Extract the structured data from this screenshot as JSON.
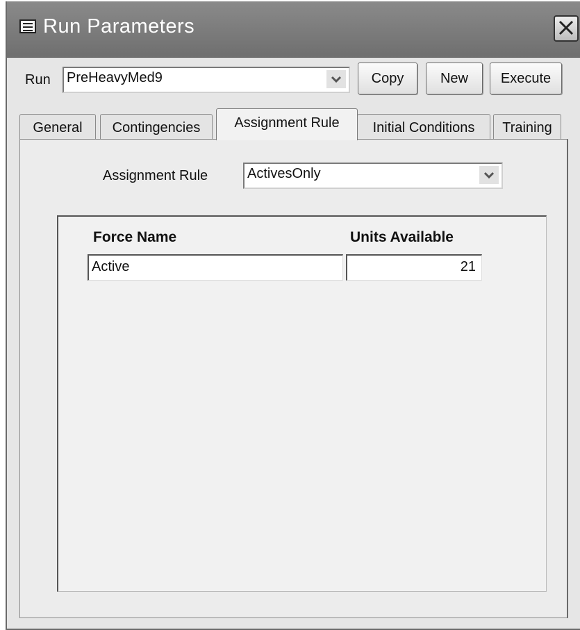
{
  "window": {
    "title": "Run Parameters"
  },
  "run": {
    "label": "Run",
    "selected": "PreHeavyMed9",
    "buttons": {
      "copy": "Copy",
      "new": "New",
      "execute": "Execute"
    }
  },
  "tabs": [
    "General",
    "Contingencies",
    "Assignment Rule",
    "Initial Conditions",
    "Training"
  ],
  "active_tab": "Assignment Rule",
  "assignment_rule": {
    "label": "Assignment Rule",
    "selected": "ActivesOnly"
  },
  "forces_table": {
    "columns": [
      "Force Name",
      "Units Available"
    ],
    "rows": [
      [
        "Active",
        "21"
      ]
    ]
  },
  "icons": {
    "window_icon": "form-icon",
    "close": "close-icon",
    "dropdown": "chevron-down-icon"
  }
}
